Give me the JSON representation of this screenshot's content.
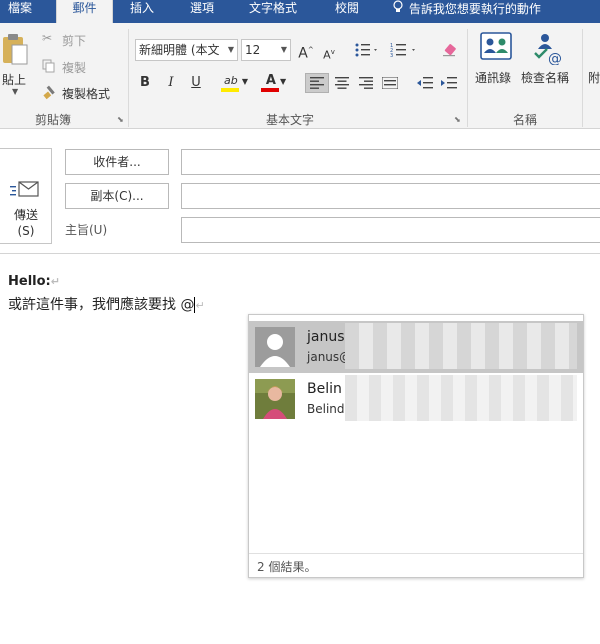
{
  "tabs": [
    "檔案",
    "郵件",
    "插入",
    "選項",
    "文字格式",
    "校閱"
  ],
  "tell_me": "告訴我您想要執行的動作",
  "clipboard": {
    "paste": "貼上",
    "cut": "剪下",
    "copy": "複製",
    "format_painter": "複製格式",
    "group_label": "剪貼簿"
  },
  "basic_text": {
    "font_name": "新細明體 (本文",
    "font_size": "12",
    "grow_font": "A",
    "shrink_font": "A",
    "bold": "B",
    "italic": "I",
    "underline": "U",
    "highlight": "ab",
    "font_color": "A",
    "group_label": "基本文字"
  },
  "names": {
    "address_book": "通訊錄",
    "check_names": "檢查名稱",
    "group_label": "名稱",
    "attach_partial": "附"
  },
  "message": {
    "send": "傳送",
    "send_key": "(S)",
    "to_button": "收件者...",
    "cc_button": "副本(C)...",
    "subject_label": "主旨(U)",
    "to_value": "",
    "cc_value": "",
    "subject_value": ""
  },
  "body": {
    "line1": "Hello:",
    "line2": "或許這件事，我們應該要找 @"
  },
  "suggestions": {
    "items": [
      {
        "name": "janus",
        "email": "janus@"
      },
      {
        "name": "Belin",
        "email": "Belind"
      }
    ],
    "footer": "2 個結果。"
  }
}
